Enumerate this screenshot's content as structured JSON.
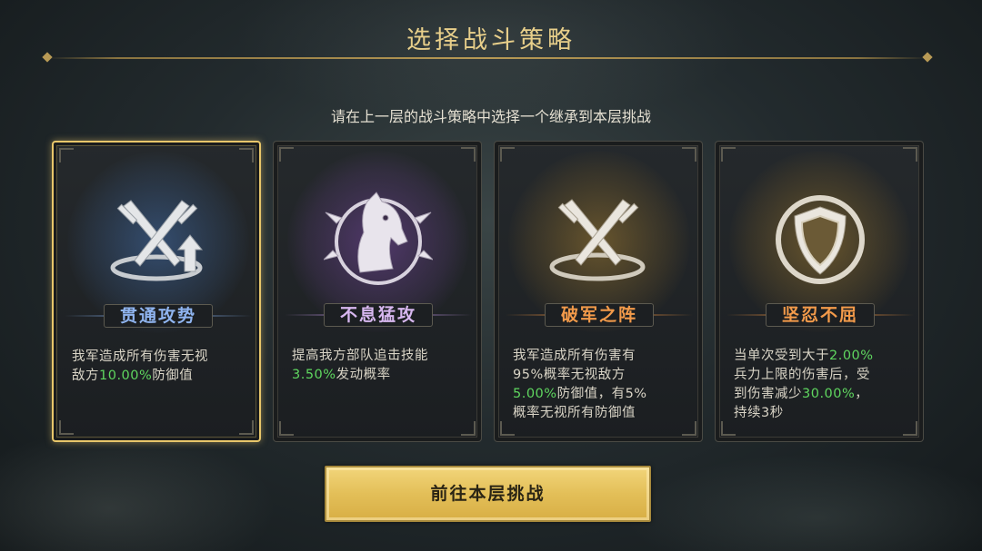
{
  "header": {
    "title": "选择战斗策略"
  },
  "instruction": "请在上一层的战斗策略中选择一个继承到本层挑战",
  "cards": [
    {
      "name": "贯通攻势",
      "icon": "crossed-swords-up-arrow-icon",
      "selected": true,
      "name_color": "#8fb4ef",
      "glow": "#3a5a86",
      "desc": {
        "l1a": "我军造成所有伤害无视",
        "l2a": "敌方",
        "l2hl": "10.00%",
        "l2b": "防御值"
      }
    },
    {
      "name": "不息猛攻",
      "icon": "horse-head-crest-icon",
      "selected": false,
      "name_color": "#d7b7ef",
      "glow": "#5c3d7a",
      "desc": {
        "l1a": "提高我方部队追击技能",
        "l2hl": "3.50%",
        "l2b": "发动概率"
      }
    },
    {
      "name": "破军之阵",
      "icon": "crossed-swords-ring-icon",
      "selected": false,
      "name_color": "#f29a4a",
      "glow": "#6a5428",
      "desc": {
        "l1a": "我军造成所有伤害有",
        "l2a": "95%概率无视敌方",
        "l3hl": "5.00%",
        "l3b": "防御值，有5%",
        "l4a": "概率无视所有防御值"
      }
    },
    {
      "name": "坚忍不屈",
      "icon": "shield-crest-icon",
      "selected": false,
      "name_color": "#f29a4a",
      "glow": "#6a5428",
      "desc": {
        "l1a": "当单次受到大于",
        "l1hl": "2.00%",
        "l2a": "兵力上限的伤害后，受",
        "l3a": "到伤害减少",
        "l3hl": "30.00%",
        "l3b": "，",
        "l4a": "持续3秒"
      }
    }
  ],
  "action": {
    "label": "前往本层挑战"
  }
}
